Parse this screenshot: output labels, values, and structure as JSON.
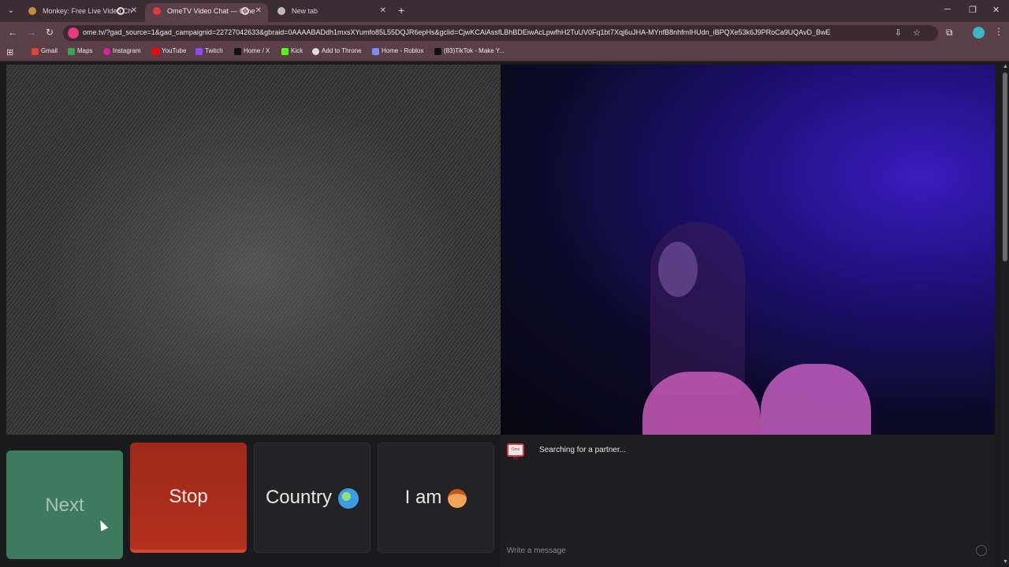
{
  "browser": {
    "tabs": [
      {
        "title": "Monkey: Free Live Video Ch",
        "favicon": "monkey-icon"
      },
      {
        "title": "OmeTV Video Chat — Ome",
        "favicon": "ometv-icon",
        "active": true
      },
      {
        "title": "New tab",
        "favicon": "chrome-icon"
      }
    ],
    "url": "ome.tv/?gad_source=1&gad_campaignid=22727042633&gbraid=0AAAABADdh1mxsXYumfo85L55DQJR6epHs&gclid=CjwKCAiAssfLBhBDEiwAcLpwfhH2TuUV0Fq1bt7Xqj6uJHA-MYnfB8nhfmIHUdn_iBPQXe53k6J9PRoCa9UQAvD_BwE",
    "bookmarks": [
      {
        "label": "Gmail",
        "icon": "gmail-icon"
      },
      {
        "label": "Maps",
        "icon": "maps-icon"
      },
      {
        "label": "Instagram",
        "icon": "instagram-icon"
      },
      {
        "label": "YouTube",
        "icon": "youtube-icon"
      },
      {
        "label": "Twitch",
        "icon": "twitch-icon"
      },
      {
        "label": "Home / X",
        "icon": "x-icon"
      },
      {
        "label": "Kick",
        "icon": "kick-icon"
      },
      {
        "label": "Add to Throne",
        "icon": "throne-icon"
      },
      {
        "label": "Home - Roblox",
        "icon": "roblox-icon"
      },
      {
        "label": "(83)TikTok - Make Y...",
        "icon": "tiktok-icon"
      }
    ]
  },
  "controls": {
    "next_label": "Next",
    "stop_label": "Stop",
    "country_label": "Country",
    "iam_label": "I am"
  },
  "chat": {
    "status": "Searching for a partner...",
    "input_placeholder": "Write a message",
    "logo_text": "Ome TV"
  },
  "colors": {
    "next": "#3e7a5e",
    "stop": "#b3311e",
    "tab_bar": "#3b2d33",
    "toolbar": "#5a3f49"
  }
}
